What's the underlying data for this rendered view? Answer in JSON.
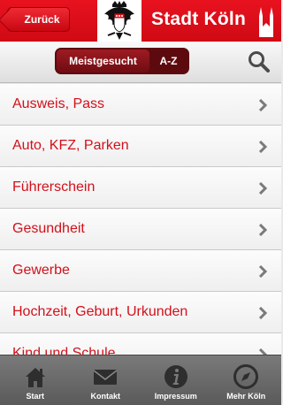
{
  "header": {
    "back_label": "Zurück",
    "brand": "Stadt Köln",
    "brand_color": "#d80f19"
  },
  "segment": {
    "items": [
      "Meistgesucht",
      "A-Z"
    ],
    "selected": "Meistgesucht"
  },
  "list": {
    "items": [
      {
        "label": "Ausweis, Pass",
        "icon": "chevron-right-icon"
      },
      {
        "label": "Auto, KFZ, Parken",
        "icon": "chevron-right-icon"
      },
      {
        "label": "Führerschein",
        "icon": "chevron-right-icon"
      },
      {
        "label": "Gesundheit",
        "icon": "chevron-right-icon"
      },
      {
        "label": "Gewerbe",
        "icon": "chevron-right-icon"
      },
      {
        "label": "Hochzeit, Geburt, Urkunden",
        "icon": "chevron-right-icon"
      },
      {
        "label": "Kind und Schule",
        "icon": "chevron-right-icon"
      }
    ]
  },
  "tabbar": {
    "items": [
      {
        "label": "Start",
        "icon": "home-icon"
      },
      {
        "label": "Kontakt",
        "icon": "mail-icon"
      },
      {
        "label": "Impressum",
        "icon": "info-icon"
      },
      {
        "label": "Mehr Köln",
        "icon": "compass-icon"
      }
    ]
  }
}
